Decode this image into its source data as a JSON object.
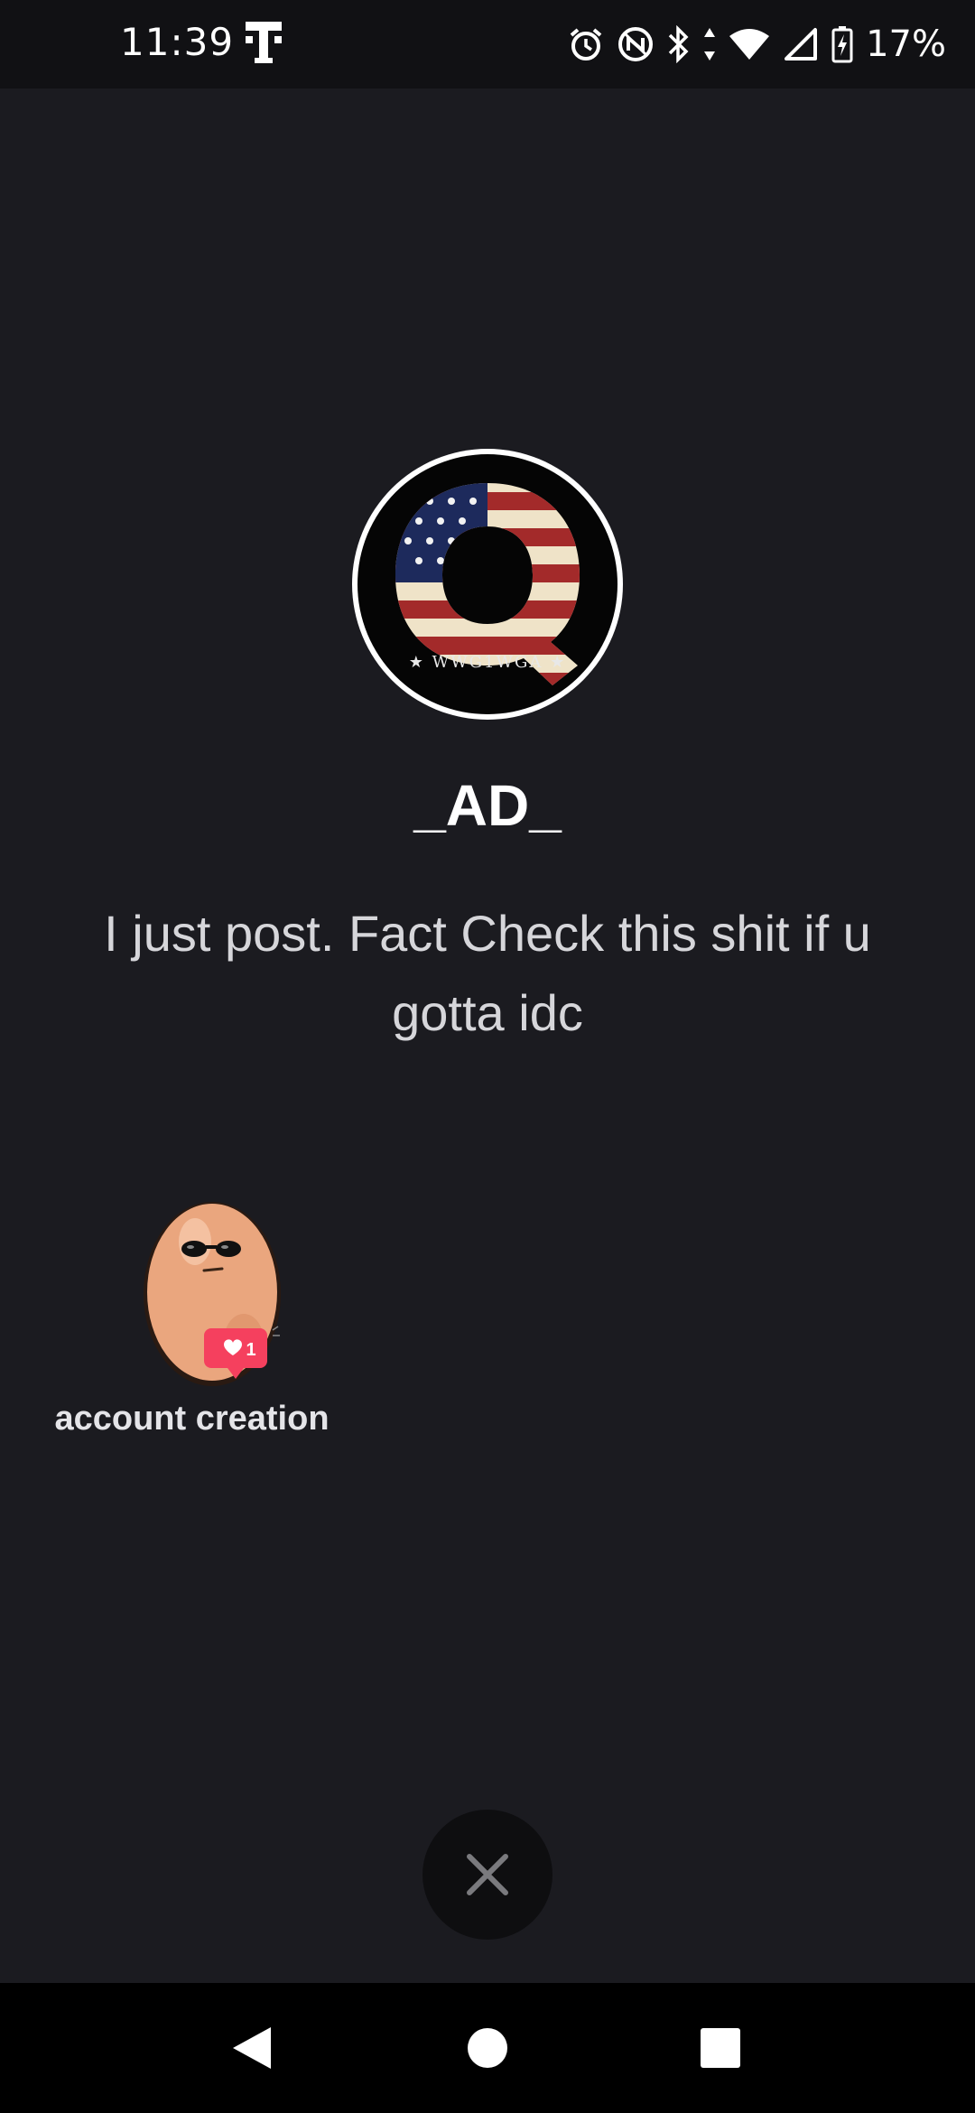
{
  "status_bar": {
    "time": "11:39",
    "battery": "17%",
    "icons": [
      "carrier-t-icon",
      "alarm-icon",
      "nfc-icon",
      "bluetooth-icon",
      "data-arrows-icon",
      "wifi-icon",
      "cell-signal-icon",
      "battery-charging-icon"
    ]
  },
  "profile": {
    "username": "_AD_",
    "bio": "I just post. Fact Check this shit if u gotta idc",
    "avatar_text": "WWG1WGA"
  },
  "badge": {
    "label": "account creation",
    "like_count": "1"
  },
  "colors": {
    "background": "#1b1b20",
    "status_bar": "#111114",
    "nav_bar": "#000000",
    "badge_heart": "#f5405e"
  },
  "navigation": {
    "icons": [
      "back-icon",
      "home-icon",
      "recents-icon"
    ]
  }
}
